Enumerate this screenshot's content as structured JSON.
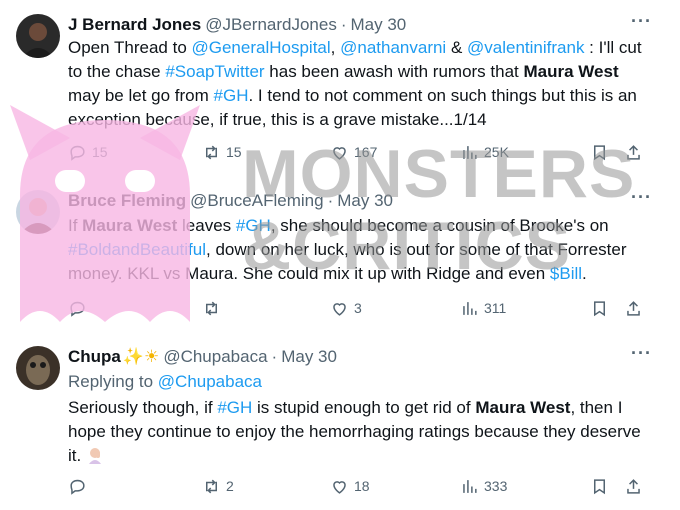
{
  "tweets": [
    {
      "name": "J Bernard Jones",
      "handle": "@JBernardJones",
      "sep": "·",
      "date": "May 30",
      "more": "···",
      "text": {
        "a": "Open Thread to ",
        "m1": "@GeneralHospital",
        "b": ", ",
        "m2": "@nathanvarni",
        "c": " & ",
        "m3": "@valentinifrank",
        "d": " : I'll cut to the chase ",
        "t1": "#SoapTwitter",
        "e": " has been awash with rumors that ",
        "s1": "Maura West",
        "f": " may be let go from ",
        "t2": "#GH",
        "g": ". I tend to not comment on such things but this is an exception because, if true, this is a grave mistake...1/14"
      },
      "stats": {
        "replies": "15",
        "reposts": "15",
        "likes": "167",
        "views": "25K"
      }
    },
    {
      "name": "Bruce Fleming",
      "handle": "@BruceAFleming",
      "sep": "·",
      "date": "May 30",
      "more": "···",
      "text": {
        "a": "If ",
        "s1": "Maura West",
        "b": " leaves ",
        "t1": "#GH",
        "c": ", she should become a cousin of Brooke's on ",
        "t2": "#BoldandBeautiful",
        "d": ", down on her luck, who is out for some of that Forrester money. KKL vs Maura. She could mix it up with Ridge and even ",
        "t3": "$Bill",
        "e": "."
      },
      "stats": {
        "replies": "",
        "reposts": "",
        "likes": "3",
        "views": "311"
      }
    },
    {
      "name": "Chupa",
      "name_emoji": "✨☀",
      "handle": "@Chupabaca",
      "sep": "·",
      "date": "May 30",
      "more": "···",
      "replying_prefix": "Replying to ",
      "replying_to": "@Chupabaca",
      "text": {
        "a": "Seriously though, if ",
        "t1": "#GH",
        "b": " is stupid enough to get rid of ",
        "s1": "Maura West",
        "c": ", then I hope they continue to enjoy the hemorrhaging ratings because they deserve it. "
      },
      "stats": {
        "replies": "",
        "reposts": "2",
        "likes": "18",
        "views": "333"
      }
    }
  ],
  "watermark": {
    "line1": "MONSTERS",
    "line2": "&CRITICS"
  },
  "colors": {
    "link": "#1d9bf0",
    "muted": "#536471",
    "text": "#0f1419",
    "watermark_pink": "#f7b7e4"
  }
}
